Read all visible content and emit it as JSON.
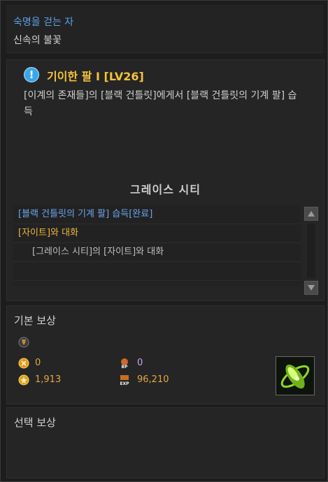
{
  "header": {
    "title": "숙명을 걷는 자",
    "subtitle": "신속의 불꽃"
  },
  "quest": {
    "icon": "exclamation-icon",
    "title": "기이한 팔 I [LV26]",
    "description": "[이계의 존재들]의 [블랙 건틀릿]에게서 [블랙 건틀릿의 기계 팔] 습득",
    "region": "그레이스 시티",
    "objectives": [
      {
        "text": "[블랙 건틀릿의 기계 팔] 습득[완료]"
      },
      {
        "text": "[자이트]와 대화"
      },
      {
        "text": "[그레이스 시티]의 [자이트]와 대화"
      }
    ]
  },
  "basic_reward": {
    "title": "기본 보상",
    "medal_icon": "medal-icon",
    "coin_value": "0",
    "bp_value": "0",
    "gold_value": "1,913",
    "exp_value": "96,210",
    "item_icon": "green-orb-item-icon"
  },
  "select_reward": {
    "title": "선택 보상"
  },
  "colors": {
    "quest_title": "#f5c23b",
    "completed": "#6ba6ee",
    "active": "#f0b43c",
    "header_title": "#5ea0e6"
  }
}
